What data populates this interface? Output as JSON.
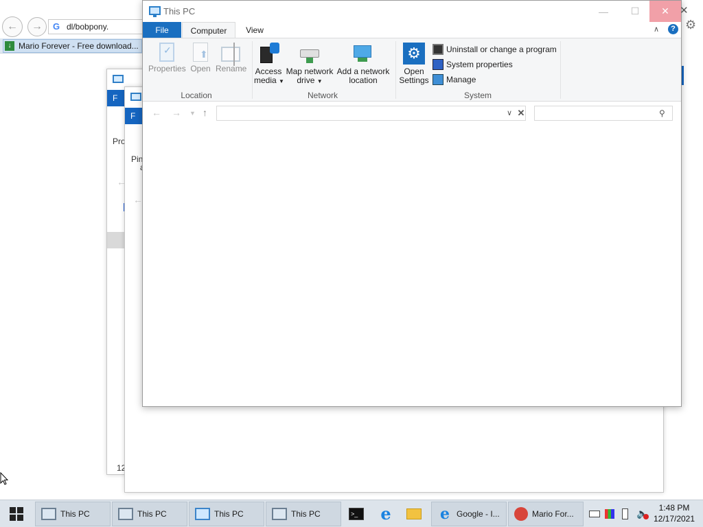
{
  "browser": {
    "address": "dl/bobpony.",
    "favorite_label": "Mario Forever - Free download..."
  },
  "bg_windows": {
    "win1_tab": "F",
    "win1_label": "Pro",
    "win1_footer": "12",
    "win2_tab": "F",
    "win2_label": "Pin",
    "win2_label2": "a"
  },
  "window": {
    "title": "This PC",
    "tabs": [
      {
        "label": "File"
      },
      {
        "label": "Computer"
      },
      {
        "label": "View"
      }
    ],
    "help_icon": "?"
  },
  "ribbon": {
    "location": {
      "label": "Location",
      "buttons": [
        {
          "label": "Properties",
          "icon": "properties-icon"
        },
        {
          "label": "Open",
          "icon": "open-icon"
        },
        {
          "label": "Rename",
          "icon": "rename-icon"
        }
      ]
    },
    "network": {
      "label": "Network",
      "buttons": [
        {
          "line1": "Access",
          "line2": "media",
          "icon": "access-media-icon"
        },
        {
          "line1": "Map network",
          "line2": "drive",
          "icon": "map-drive-icon"
        },
        {
          "line1": "Add a network",
          "line2": "location",
          "icon": "network-location-icon"
        }
      ]
    },
    "system": {
      "label": "System",
      "open_settings": {
        "line1": "Open",
        "line2": "Settings"
      },
      "items": [
        {
          "label": "Uninstall or change a program",
          "icon": "uninstall-icon"
        },
        {
          "label": "System properties",
          "icon": "system-properties-icon"
        },
        {
          "label": "Manage",
          "icon": "manage-icon"
        }
      ]
    }
  },
  "address_bar": {
    "path": "",
    "search_placeholder": ""
  },
  "taskbar": {
    "items": [
      {
        "label": "This PC"
      },
      {
        "label": "This PC"
      },
      {
        "label": "This PC"
      },
      {
        "label": "This PC"
      },
      {
        "label": "Google - I..."
      },
      {
        "label": "Mario For..."
      }
    ],
    "time": "1:48 PM",
    "date": "12/17/2021"
  }
}
